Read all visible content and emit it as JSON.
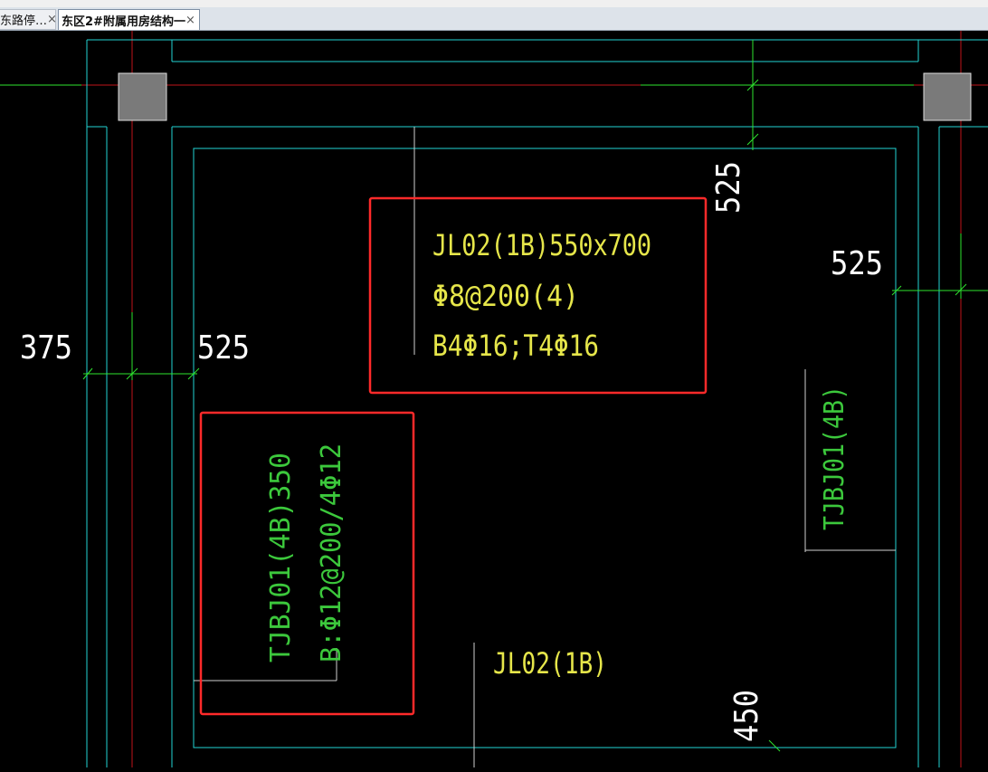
{
  "tabs": [
    {
      "label": "东路停…",
      "close": "×"
    },
    {
      "label": "东区2#附属用房结构一",
      "close": "×"
    }
  ],
  "drawing": {
    "dims": {
      "top_right_vertical": "525",
      "right_horizontal": "525",
      "left_375": "375",
      "left_525": "525",
      "bottom_450": "450"
    },
    "beam_annotation": {
      "line1": "JL02(1B)550x700",
      "line2": "Φ8@200(4)",
      "line3": "B4Φ16;T4Φ16"
    },
    "base_annotation": {
      "line1": "TJBJ01(4B)350",
      "line2": "B:Φ12@200/4Φ12"
    },
    "right_label": "TJBJ01(4B)",
    "bottom_label": "JL02(1B)",
    "colors": {
      "cyan": "#22d3d3",
      "red_axis": "#c0151a",
      "green_dim": "#2ee52e",
      "yellow_text": "#e6e64a",
      "green_text": "#3cc83c",
      "white_text": "#ffffff",
      "highlight": "#ff2a2a",
      "column": "#7a7a7a"
    }
  }
}
